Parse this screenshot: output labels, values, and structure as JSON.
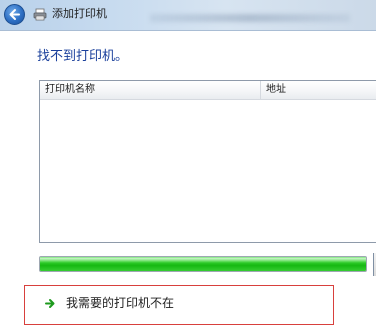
{
  "window": {
    "title": "添加打印机"
  },
  "main": {
    "heading": "找不到打印机。",
    "list": {
      "columns": [
        "打印机名称",
        "地址"
      ],
      "rows": []
    },
    "progress": {
      "fraction": 1.0
    },
    "link_label": "我需要的打印机不在"
  },
  "colors": {
    "heading": "#1a3f9b",
    "progress": "#16b812",
    "highlight_border": "#d8403d"
  },
  "icons": {
    "back": "back-arrow-icon",
    "printer": "printer-icon",
    "link": "green-arrow-icon"
  }
}
